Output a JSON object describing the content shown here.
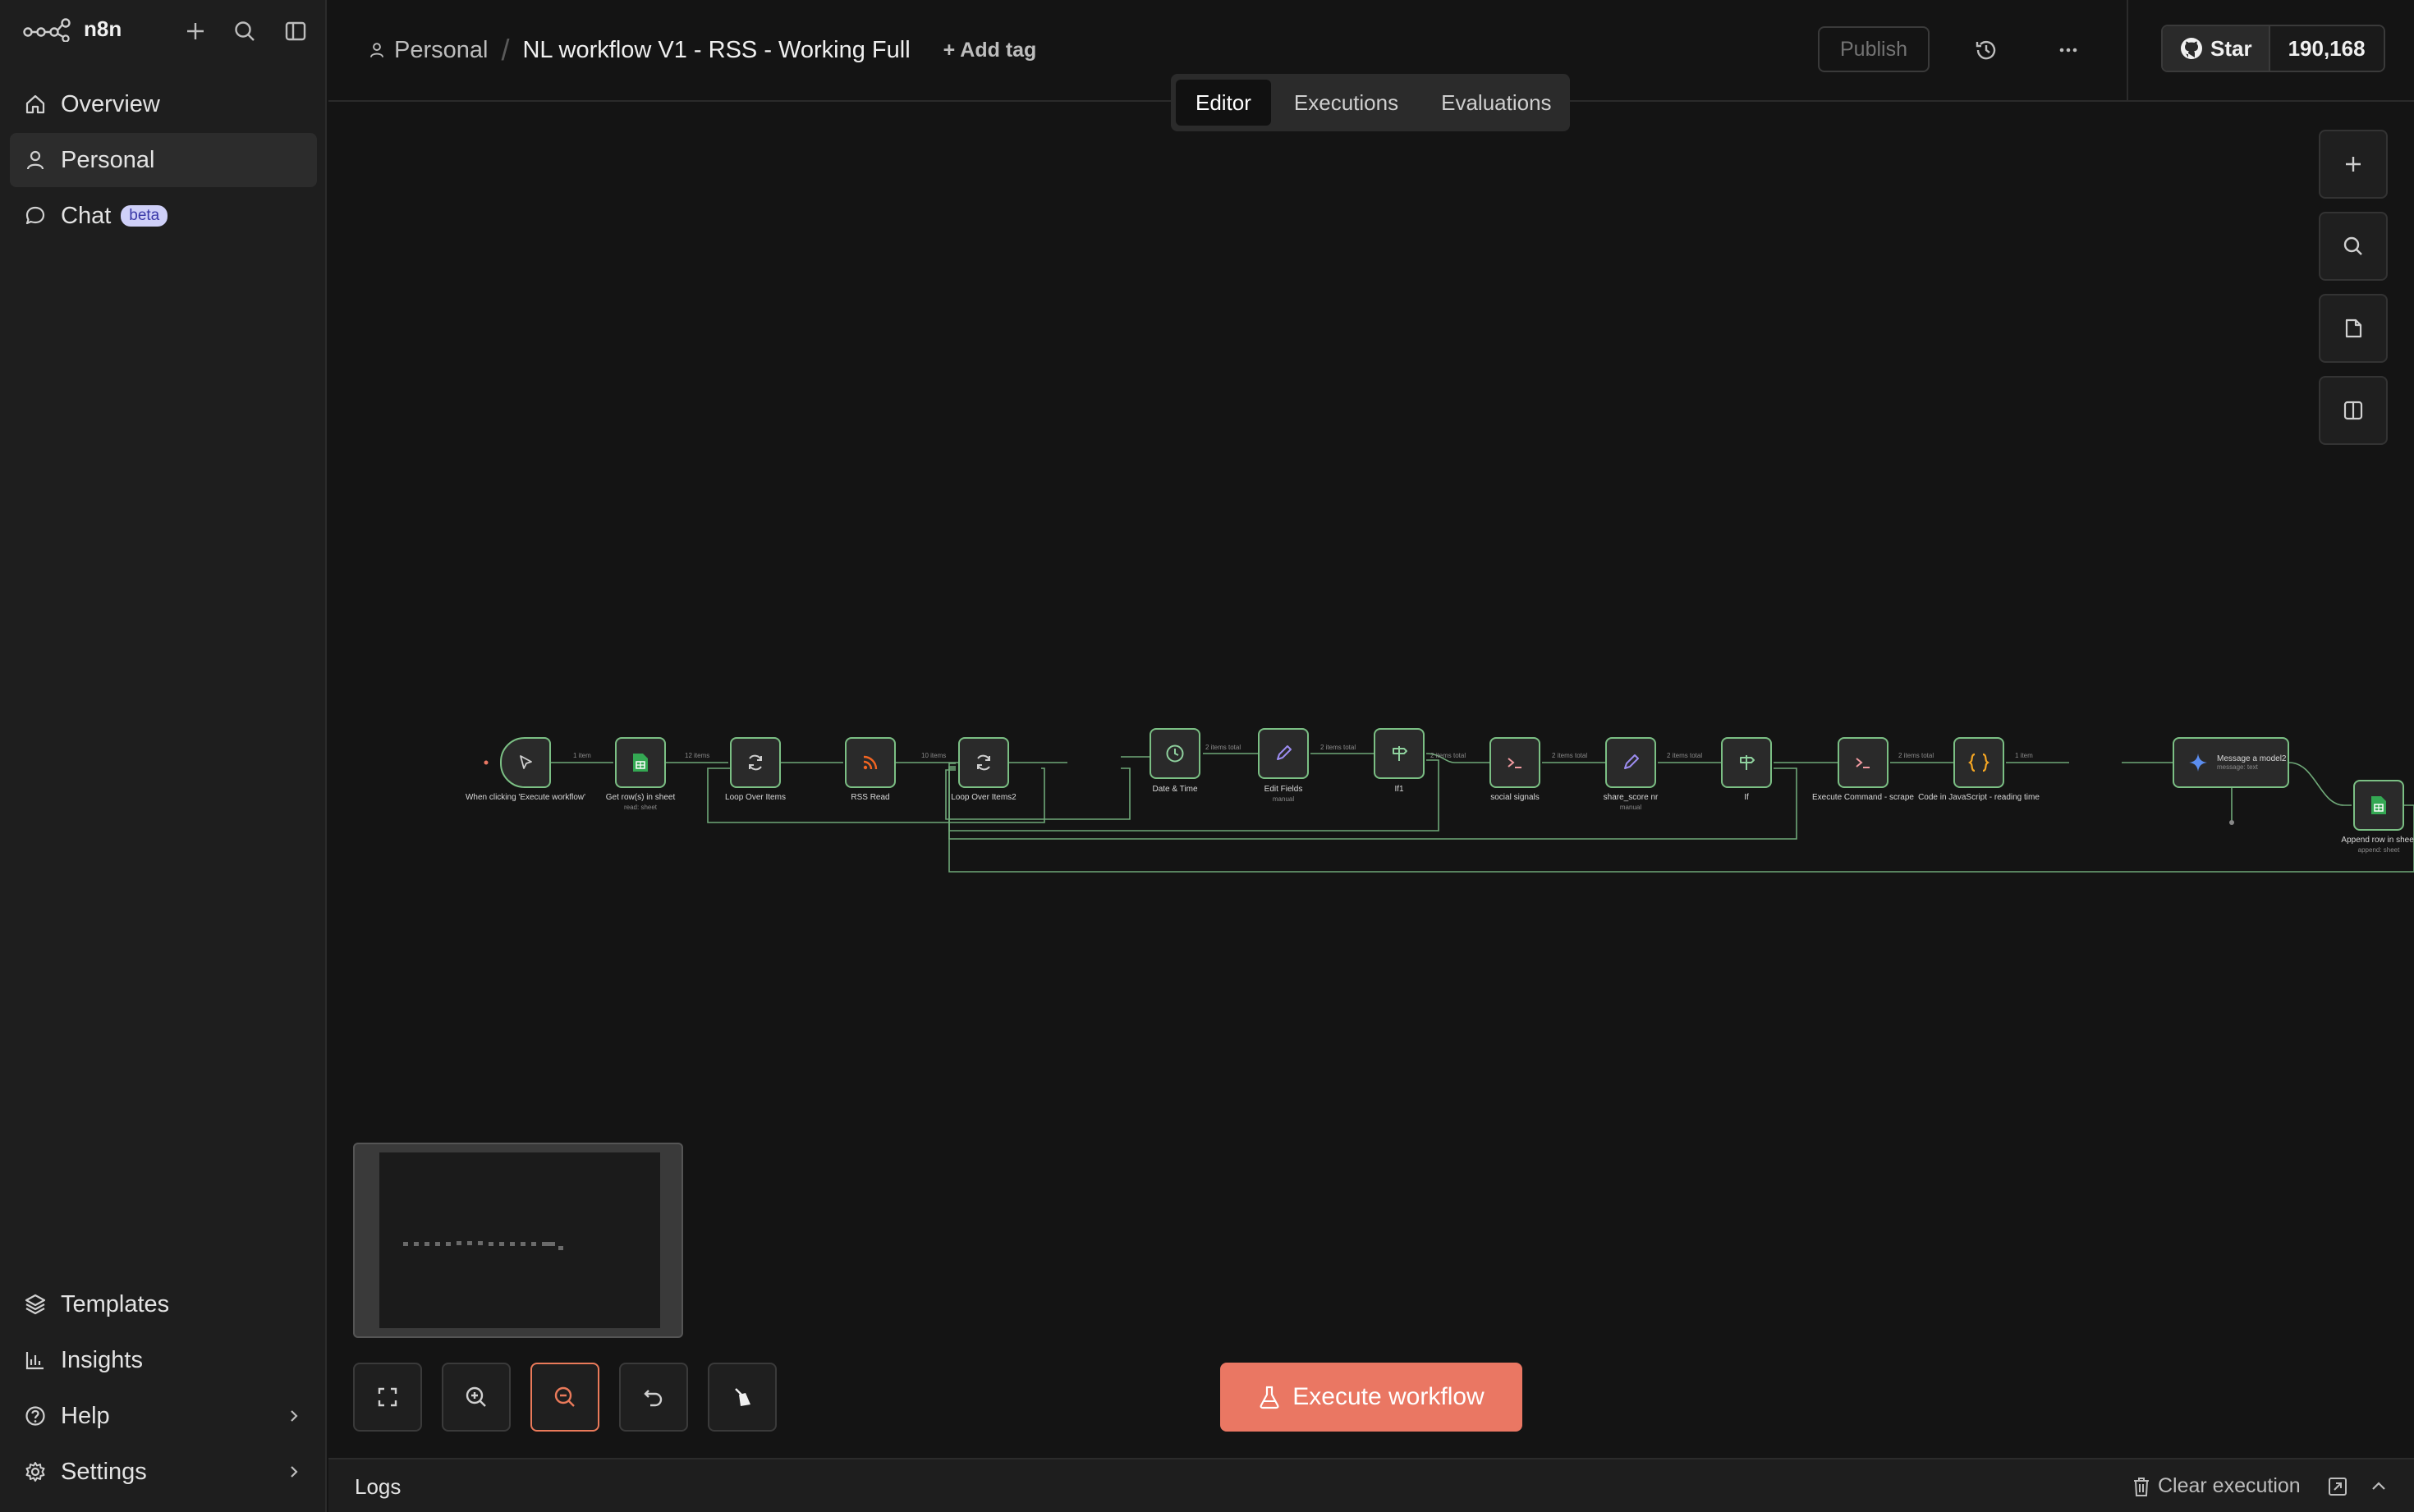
{
  "app": {
    "name": "n8n"
  },
  "sidebar": {
    "items": [
      {
        "label": "Overview"
      },
      {
        "label": "Personal"
      },
      {
        "label": "Chat",
        "badge": "beta"
      }
    ],
    "bottom": [
      {
        "label": "Templates"
      },
      {
        "label": "Insights"
      },
      {
        "label": "Help"
      },
      {
        "label": "Settings"
      }
    ]
  },
  "header": {
    "project": "Personal",
    "workflow_name": "NL workflow V1 - RSS - Working Full",
    "add_tag": "+ Add tag",
    "publish": "Publish",
    "github_star": "Star",
    "github_count": "190,168"
  },
  "tabs": [
    {
      "label": "Editor"
    },
    {
      "label": "Executions"
    },
    {
      "label": "Evaluations"
    }
  ],
  "workflow": {
    "nodes": [
      {
        "label": "When clicking 'Execute workflow'",
        "sub": ""
      },
      {
        "label": "Get row(s) in sheet",
        "sub": "read: sheet"
      },
      {
        "label": "Loop Over Items",
        "sub": ""
      },
      {
        "label": "RSS Read",
        "sub": ""
      },
      {
        "label": "Loop Over Items2",
        "sub": ""
      },
      {
        "label": "Date & Time",
        "sub": ""
      },
      {
        "label": "Edit Fields",
        "sub": "manual"
      },
      {
        "label": "If1",
        "sub": ""
      },
      {
        "label": "social signals",
        "sub": ""
      },
      {
        "label": "share_score nr",
        "sub": "manual"
      },
      {
        "label": "If",
        "sub": ""
      },
      {
        "label": "Execute Command - scrape",
        "sub": ""
      },
      {
        "label": "Code in JavaScript - reading time",
        "sub": ""
      },
      {
        "label": "Message a model2",
        "sub": "message: text"
      },
      {
        "label": "Append row in sheet",
        "sub": "append: sheet"
      }
    ],
    "edges": [
      {
        "label": "1 item"
      },
      {
        "label": "12 items"
      },
      {
        "label": "10 items"
      },
      {
        "label": "2 items total"
      },
      {
        "label": "2 items total"
      },
      {
        "label": "2 items total"
      },
      {
        "label": "2 items total"
      },
      {
        "label": "2 items total"
      },
      {
        "label": "2 items total"
      },
      {
        "label": "1 item"
      }
    ]
  },
  "actions": {
    "execute": "Execute workflow"
  },
  "logs": {
    "title": "Logs",
    "clear": "Clear execution"
  },
  "colors": {
    "accent": "#ea7763",
    "node_border": "#7bbf84",
    "beta_bg": "#cfd0f8"
  }
}
